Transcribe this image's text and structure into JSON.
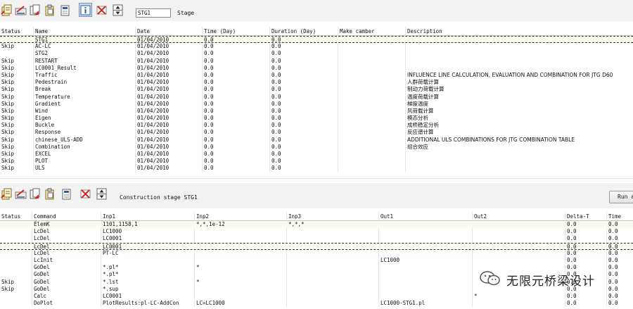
{
  "toolbar1": {
    "stage_value": "STG1",
    "stage_label": "Stage"
  },
  "toolbar2": {
    "label": "Construction stage STG1",
    "run_label": "Run a"
  },
  "stages": {
    "headers": [
      "Status",
      "Name",
      "Date",
      "Time (Day)",
      "Duration (Day)",
      "Make camber",
      "Description"
    ],
    "rows": [
      {
        "status": "",
        "name": "STG1",
        "date": "01/04/2010",
        "time": "0.0",
        "duration": "0.0",
        "camber": "",
        "desc": ""
      },
      {
        "status": "Skip",
        "name": "AC-LC",
        "date": "01/04/2010",
        "time": "0.0",
        "duration": "0.0",
        "camber": "",
        "desc": ""
      },
      {
        "status": "",
        "name": "STG2",
        "date": "01/04/2010",
        "time": "0.0",
        "duration": "0.0",
        "camber": "",
        "desc": ""
      },
      {
        "status": "Skip",
        "name": "RESTART",
        "date": "01/04/2010",
        "time": "0.0",
        "duration": "0.0",
        "camber": "",
        "desc": ""
      },
      {
        "status": "Skip",
        "name": "LC0001_Result",
        "date": "01/04/2010",
        "time": "0.0",
        "duration": "0.0",
        "camber": "",
        "desc": ""
      },
      {
        "status": "Skip",
        "name": "Traffic",
        "date": "01/04/2010",
        "time": "0.0",
        "duration": "0.0",
        "camber": "",
        "desc": "INFLUENCE LINE CALCULATION, EVALUATION AND COMBINATION FOR JTG D60"
      },
      {
        "status": "Skip",
        "name": "Pedestrain",
        "date": "01/04/2010",
        "time": "0.0",
        "duration": "0.0",
        "camber": "",
        "desc": "人群荷载计算"
      },
      {
        "status": "Skip",
        "name": "Break",
        "date": "01/04/2010",
        "time": "0.0",
        "duration": "0.0",
        "camber": "",
        "desc": "制动力荷载计算"
      },
      {
        "status": "Skip",
        "name": "Temperature",
        "date": "01/04/2010",
        "time": "0.0",
        "duration": "0.0",
        "camber": "",
        "desc": "温度荷载计算"
      },
      {
        "status": "Skip",
        "name": "Gradient",
        "date": "01/04/2010",
        "time": "0.0",
        "duration": "0.0",
        "camber": "",
        "desc": "梯度温度"
      },
      {
        "status": "Skip",
        "name": "Wind",
        "date": "01/04/2010",
        "time": "0.0",
        "duration": "0.0",
        "camber": "",
        "desc": "风荷载计算"
      },
      {
        "status": "Skip",
        "name": "Eigen",
        "date": "01/04/2010",
        "time": "0.0",
        "duration": "0.0",
        "camber": "",
        "desc": "模态分析"
      },
      {
        "status": "Skip",
        "name": "Buckle",
        "date": "01/04/2010",
        "time": "0.0",
        "duration": "0.0",
        "camber": "",
        "desc": "成桥稳定分析"
      },
      {
        "status": "Skip",
        "name": "Response",
        "date": "01/04/2010",
        "time": "0.0",
        "duration": "0.0",
        "camber": "",
        "desc": "反应谱计算"
      },
      {
        "status": "Skip",
        "name": "chinese_ULS-ADD",
        "date": "01/04/2010",
        "time": "0.0",
        "duration": "0.0",
        "camber": "",
        "desc": "ADDITIONAL ULS COMBINATIONS FOR JTG COMBINATION TABLE"
      },
      {
        "status": "Skip",
        "name": "Combination",
        "date": "01/04/2010",
        "time": "0.0",
        "duration": "0.0",
        "camber": "",
        "desc": "组合效应"
      },
      {
        "status": "Skip",
        "name": "EXCEL",
        "date": "01/04/2010",
        "time": "0.0",
        "duration": "0.0",
        "camber": "",
        "desc": ""
      },
      {
        "status": "Skip",
        "name": "PLOT",
        "date": "01/04/2010",
        "time": "0.0",
        "duration": "0.0",
        "camber": "",
        "desc": ""
      },
      {
        "status": "Skip",
        "name": "ULS",
        "date": "01/04/2010",
        "time": "0.0",
        "duration": "0.0",
        "camber": "",
        "desc": ""
      }
    ]
  },
  "commands": {
    "headers": [
      "Status",
      "Command",
      "Inp1",
      "Inp2",
      "Inp3",
      "Out1",
      "Out2",
      "Delta-T",
      "Time"
    ],
    "rows": [
      {
        "status": "",
        "command": "ElemK",
        "inp1": "1101,1158,1",
        "inp2": "*,*,1e-12",
        "inp3": "*,*,*",
        "out1": "",
        "out2": "",
        "dt": "0.0",
        "time": "0.0"
      },
      {
        "status": "",
        "command": "LcDel",
        "inp1": "LC1000",
        "inp2": "",
        "inp3": "",
        "out1": "",
        "out2": "",
        "dt": "0.0",
        "time": "0.0"
      },
      {
        "status": "",
        "command": "LcDel",
        "inp1": "LC0001",
        "inp2": "",
        "inp3": "",
        "out1": "",
        "out2": "",
        "dt": "0.0",
        "time": "0.0"
      },
      {
        "status": "",
        "command": "LcDel",
        "inp1": "LC0001",
        "inp2": "",
        "inp3": "",
        "out1": "",
        "out2": "",
        "dt": "0.0",
        "time": "0.0"
      },
      {
        "status": "",
        "command": "LcDel",
        "inp1": "PT-LC",
        "inp2": "",
        "inp3": "",
        "out1": "",
        "out2": "",
        "dt": "0.0",
        "time": "0.0"
      },
      {
        "status": "",
        "command": "LcInit",
        "inp1": "",
        "inp2": "",
        "inp3": "",
        "out1": "LC1000",
        "out2": "",
        "dt": "0.0",
        "time": "0.0"
      },
      {
        "status": "",
        "command": "GoDel",
        "inp1": "*.pl*",
        "inp2": "*",
        "inp3": "",
        "out1": "",
        "out2": "",
        "dt": "0.0",
        "time": "0.0"
      },
      {
        "status": "",
        "command": "GoDel",
        "inp1": "*.pl*",
        "inp2": "",
        "inp3": "",
        "out1": "",
        "out2": "",
        "dt": "0.0",
        "time": "0.0"
      },
      {
        "status": "Skip",
        "command": "GoDel",
        "inp1": "*.lst",
        "inp2": "*",
        "inp3": "",
        "out1": "",
        "out2": "",
        "dt": "0.0",
        "time": "0.0"
      },
      {
        "status": "Skip",
        "command": "GoDel",
        "inp1": "*.sup",
        "inp2": "",
        "inp3": "",
        "out1": "",
        "out2": "",
        "dt": "0.0",
        "time": "0.0"
      },
      {
        "status": "",
        "command": "Calc",
        "inp1": "LC0001",
        "inp2": "",
        "inp3": "",
        "out1": "",
        "out2": "*",
        "dt": "0.0",
        "time": "0.0"
      },
      {
        "status": "",
        "command": "DoPlot",
        "inp1": "PlotResults:pl-LC-AddCon",
        "inp2": "LC=LC1000",
        "inp3": "",
        "out1": "LC1000-STG1.pl",
        "out2": "",
        "dt": "0.0",
        "time": "0.0"
      }
    ]
  },
  "watermark": {
    "text": "无限元桥梁设计"
  },
  "colors": {
    "selection": "#fbfbf0",
    "accent_red": "#d4261d",
    "accent_blue": "#2d5da8"
  }
}
